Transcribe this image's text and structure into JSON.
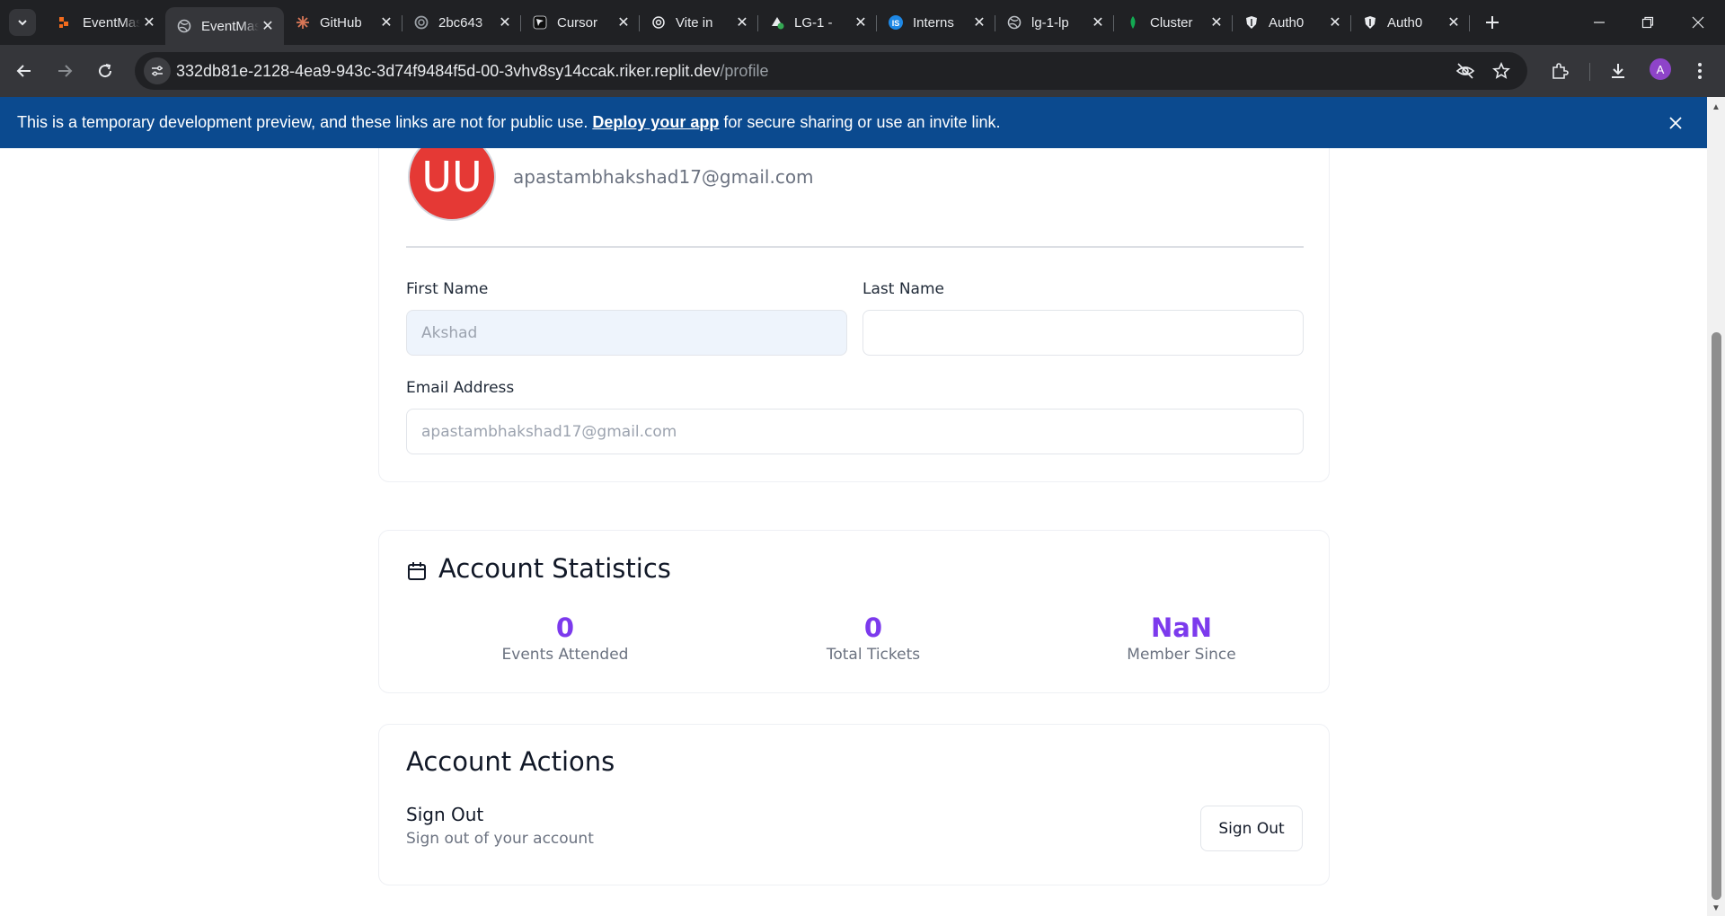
{
  "browser": {
    "tabs": [
      {
        "title": "EventMaster",
        "favicon": "event-orange-icon",
        "active": false
      },
      {
        "title": "EventMaster",
        "favicon": "globe-icon",
        "active": true
      },
      {
        "title": "GitHub",
        "favicon": "claude-spark-icon",
        "active": false
      },
      {
        "title": "2bc643",
        "favicon": "replit-circle-icon",
        "active": false
      },
      {
        "title": "Cursor",
        "favicon": "cursor-icon",
        "active": false
      },
      {
        "title": "Vite in",
        "favicon": "openai-icon",
        "active": false
      },
      {
        "title": "LG-1 -",
        "favicon": "lg-check-icon",
        "active": false
      },
      {
        "title": "Interns",
        "favicon": "is-badge-icon",
        "active": false
      },
      {
        "title": "lg-1-lp",
        "favicon": "globe-icon",
        "active": false
      },
      {
        "title": "Cluster",
        "favicon": "mongodb-leaf-icon",
        "active": false
      },
      {
        "title": "Auth0",
        "favicon": "auth0-shield-icon",
        "active": false
      },
      {
        "title": "Auth0",
        "favicon": "auth0-shield-icon",
        "active": false
      }
    ],
    "address": {
      "host": "332db81e-2128-4ea9-943c-3d74f9484f5d-00-3vhv8sy14ccak.riker.replit.dev",
      "path": "/profile"
    },
    "profile_initial": "A"
  },
  "banner": {
    "text_before": "This is a temporary development preview, and these links are not for public use. ",
    "link": "Deploy your app",
    "text_after": " for secure sharing or use an invite link."
  },
  "profile": {
    "initials": "UU",
    "email": "apastambhakshad17@gmail.com",
    "first_name_label": "First Name",
    "first_name_value": "Akshad",
    "last_name_label": "Last Name",
    "last_name_value": "",
    "email_label": "Email Address",
    "email_value": "apastambhakshad17@gmail.com"
  },
  "stats": {
    "title": "Account Statistics",
    "items": [
      {
        "value": "0",
        "label": "Events Attended"
      },
      {
        "value": "0",
        "label": "Total Tickets"
      },
      {
        "value": "NaN",
        "label": "Member Since"
      }
    ]
  },
  "actions": {
    "title": "Account Actions",
    "signout_title": "Sign Out",
    "signout_desc": "Sign out of your account",
    "signout_button": "Sign Out"
  },
  "colors": {
    "banner": "#0b4a8f",
    "accent": "#7c3aed",
    "avatar": "#e53935"
  }
}
